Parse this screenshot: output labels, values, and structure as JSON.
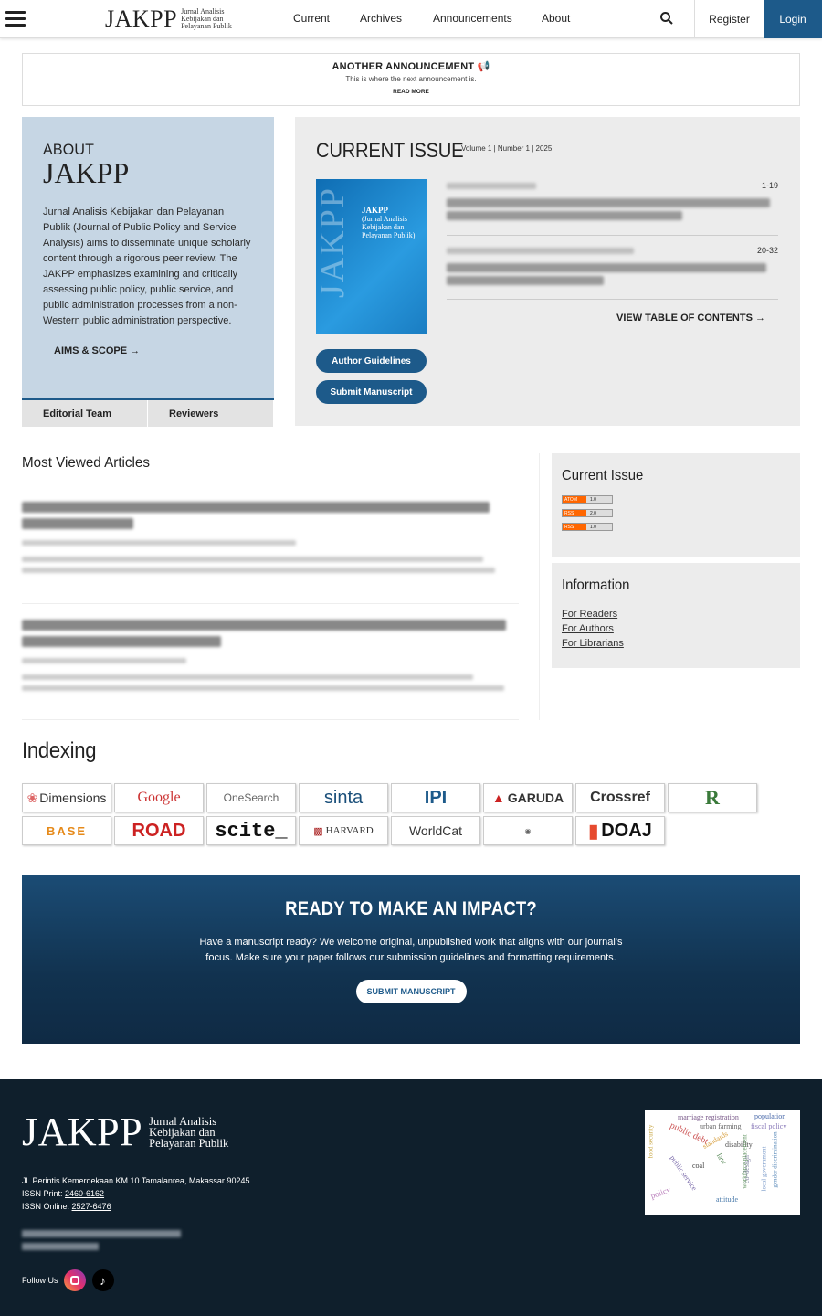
{
  "header": {
    "logo_big": "JAKPP",
    "logo_small_1": "Jurnal Analisis",
    "logo_small_2": "Kebijakan dan",
    "logo_small_3": "Pelayanan Publik",
    "nav": [
      "Current",
      "Archives",
      "Announcements",
      "About"
    ],
    "register": "Register",
    "login": "Login"
  },
  "announcement": {
    "title": "ANOTHER ANNOUNCEMENT",
    "description": "This is where the next announcement is.",
    "read_more": "READ MORE"
  },
  "about": {
    "heading": "ABOUT",
    "name": "JAKPP",
    "text": "Jurnal Analisis Kebijakan dan Pelayanan Publik (Journal of Public Policy and Service Analysis) aims to disseminate unique scholarly content through a rigorous peer review. The JAKPP emphasizes examining and critically assessing public policy, public service, and public administration processes from a non-Western public administration perspective.",
    "aims": "AIMS & SCOPE →",
    "tabs": [
      "Editorial Team",
      "Reviewers"
    ]
  },
  "current_issue": {
    "heading": "CURRENT ISSUE",
    "volume": "Volume 1 | Number 1 | 2025",
    "cover_title": "JAKPP",
    "cover_sub_1": "(Jurnal Analisis",
    "cover_sub_2": "Kebijakan dan",
    "cover_sub_3": "Pelayanan Publik)",
    "author_guidelines": "Author Guidelines",
    "submit_manuscript": "Submit Manuscript",
    "articles": [
      {
        "pages": "1-19"
      },
      {
        "pages": "20-32"
      }
    ],
    "toc": "VIEW TABLE OF CONTENTS →"
  },
  "most_viewed": {
    "heading": "Most Viewed Articles"
  },
  "sidebar": {
    "current_issue": "Current Issue",
    "feeds": [
      {
        "label": "ATOM",
        "ver": "1.0"
      },
      {
        "label": "RSS",
        "ver": "2.0"
      },
      {
        "label": "RSS",
        "ver": "1.0"
      }
    ],
    "information": "Information",
    "links": [
      "For Readers",
      "For Authors",
      "For Librarians"
    ]
  },
  "indexing": {
    "heading": "Indexing",
    "logos": [
      "Dimensions",
      "Google",
      "OneSearch",
      "sinta",
      "IPI",
      "GARUDA",
      "Crossref",
      "R",
      "BASE",
      "ROAD",
      "scite_",
      "HARVARD",
      "WorldCat",
      "",
      "",
      "DOAJ"
    ]
  },
  "cta": {
    "heading": "READY TO MAKE AN IMPACT?",
    "text": "Have a manuscript ready? We welcome original, unpublished work that aligns with our journal’s focus. Make sure your paper follows our submission guidelines and formatting requirements.",
    "button": "SUBMIT MANUSCRIPT"
  },
  "footer": {
    "logo_big": "JAKPP",
    "logo_small_1": "Jurnal Analisis",
    "logo_small_2": "Kebijakan dan",
    "logo_small_3": "Pelayanan Publik",
    "address": "Jl. Perintis Kemerdekaan KM.10 Tamalanrea, Makassar 90245",
    "issn_print_label": "ISSN Print: ",
    "issn_print": "2460-6162",
    "issn_online_label": "ISSN Online: ",
    "issn_online": "2527-6476",
    "follow": "Follow Us",
    "cloud_words": [
      "marriage registration",
      "population",
      "urban farming",
      "fiscal policy",
      "public debt",
      "disability",
      "standards",
      "food security",
      "coal",
      "policy",
      "public service",
      "attitude",
      "law",
      "co-design",
      "local government",
      "gender discrimination",
      "workforce placement"
    ]
  },
  "colors": {
    "brand": "#1d5a8a",
    "about_bg": "#c6d6e4",
    "footer_bg": "#0f1f2c"
  }
}
